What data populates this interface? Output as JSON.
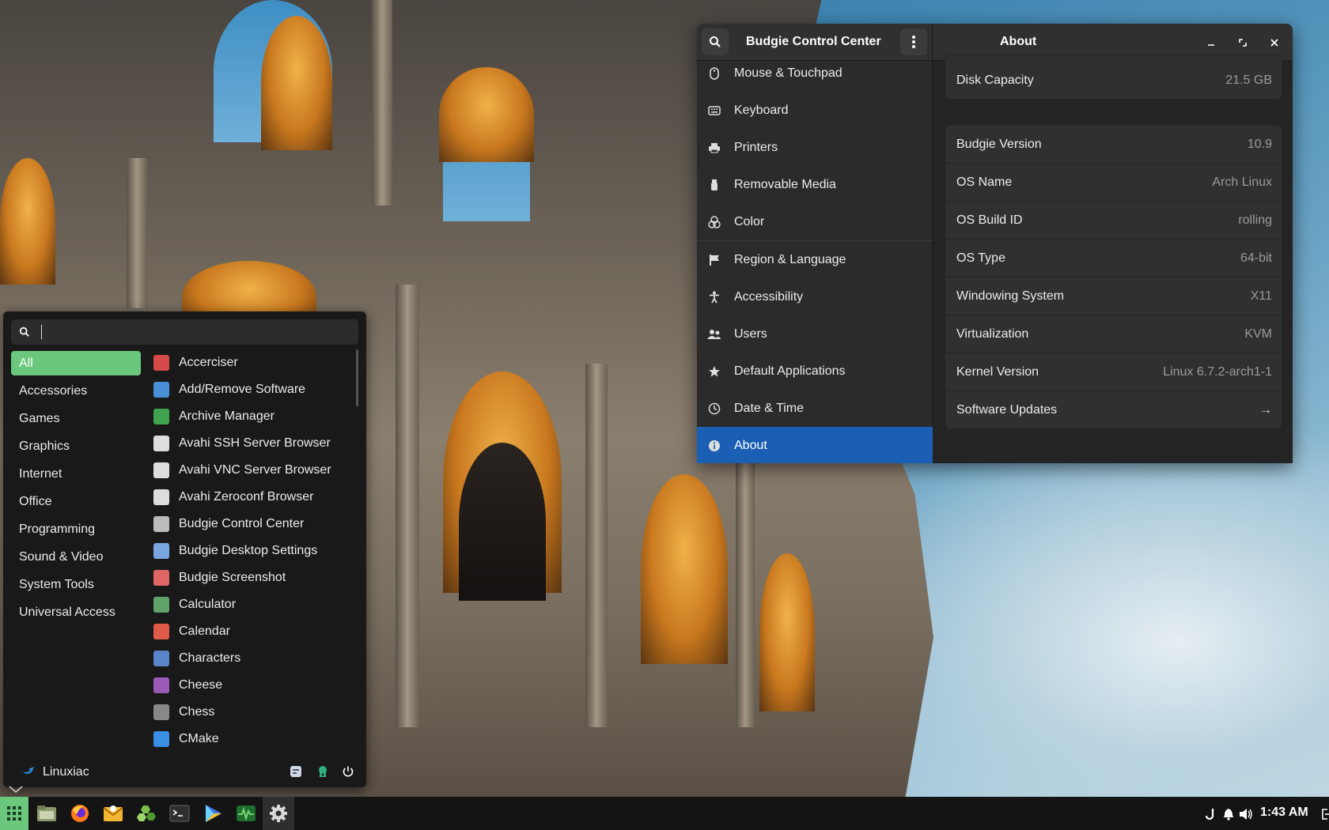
{
  "control_center": {
    "title": "Budgie Control Center",
    "page_title": "About",
    "sidebar": [
      {
        "label": "Mouse & Touchpad",
        "icon": "mouse-icon"
      },
      {
        "label": "Keyboard",
        "icon": "keyboard-icon"
      },
      {
        "label": "Printers",
        "icon": "printer-icon"
      },
      {
        "label": "Removable Media",
        "icon": "usb-icon"
      },
      {
        "label": "Color",
        "icon": "color-icon"
      },
      {
        "label": "Region & Language",
        "icon": "flag-icon"
      },
      {
        "label": "Accessibility",
        "icon": "accessibility-icon"
      },
      {
        "label": "Users",
        "icon": "users-icon"
      },
      {
        "label": "Default Applications",
        "icon": "star-icon"
      },
      {
        "label": "Date & Time",
        "icon": "clock-icon"
      },
      {
        "label": "About",
        "icon": "info-icon",
        "active": true
      }
    ],
    "disk": {
      "label": "Disk Capacity",
      "value": "21.5 GB"
    },
    "details": [
      {
        "label": "Budgie Version",
        "value": "10.9"
      },
      {
        "label": "OS Name",
        "value": "Arch Linux"
      },
      {
        "label": "OS Build ID",
        "value": "rolling"
      },
      {
        "label": "OS Type",
        "value": "64-bit"
      },
      {
        "label": "Windowing System",
        "value": "X11"
      },
      {
        "label": "Virtualization",
        "value": "KVM"
      },
      {
        "label": "Kernel Version",
        "value": "Linux 6.7.2-arch1-1"
      },
      {
        "label": "Software Updates",
        "value": "→"
      }
    ]
  },
  "menu": {
    "search_value": "",
    "categories": [
      "All",
      "Accessories",
      "Games",
      "Graphics",
      "Internet",
      "Office",
      "Programming",
      "Sound & Video",
      "System Tools",
      "Universal Access"
    ],
    "active_category": "All",
    "apps": [
      {
        "label": "Accerciser",
        "color": "#d64a4a"
      },
      {
        "label": "Add/Remove Software",
        "color": "#4a90d9"
      },
      {
        "label": "Archive Manager",
        "color": "#3fa34d"
      },
      {
        "label": "Avahi SSH Server Browser",
        "color": "#dddddd"
      },
      {
        "label": "Avahi VNC Server Browser",
        "color": "#dddddd"
      },
      {
        "label": "Avahi Zeroconf Browser",
        "color": "#dddddd"
      },
      {
        "label": "Budgie Control Center",
        "color": "#bbbbbb"
      },
      {
        "label": "Budgie Desktop Settings",
        "color": "#7aa6e0"
      },
      {
        "label": "Budgie Screenshot",
        "color": "#e06666"
      },
      {
        "label": "Calculator",
        "color": "#5fa36b"
      },
      {
        "label": "Calendar",
        "color": "#e05a4a"
      },
      {
        "label": "Characters",
        "color": "#5a86c9"
      },
      {
        "label": "Cheese",
        "color": "#9b59b6"
      },
      {
        "label": "Chess",
        "color": "#888888"
      },
      {
        "label": "CMake",
        "color": "#3a8ee6"
      }
    ],
    "user": "Linuxiac"
  },
  "taskbar": {
    "clock": "1:43 AM",
    "apps": [
      "app-grid-icon",
      "files-icon",
      "firefox-icon",
      "mail-icon",
      "hex-icon",
      "terminal-icon",
      "media-player-icon",
      "system-monitor-icon",
      "settings-icon"
    ]
  }
}
